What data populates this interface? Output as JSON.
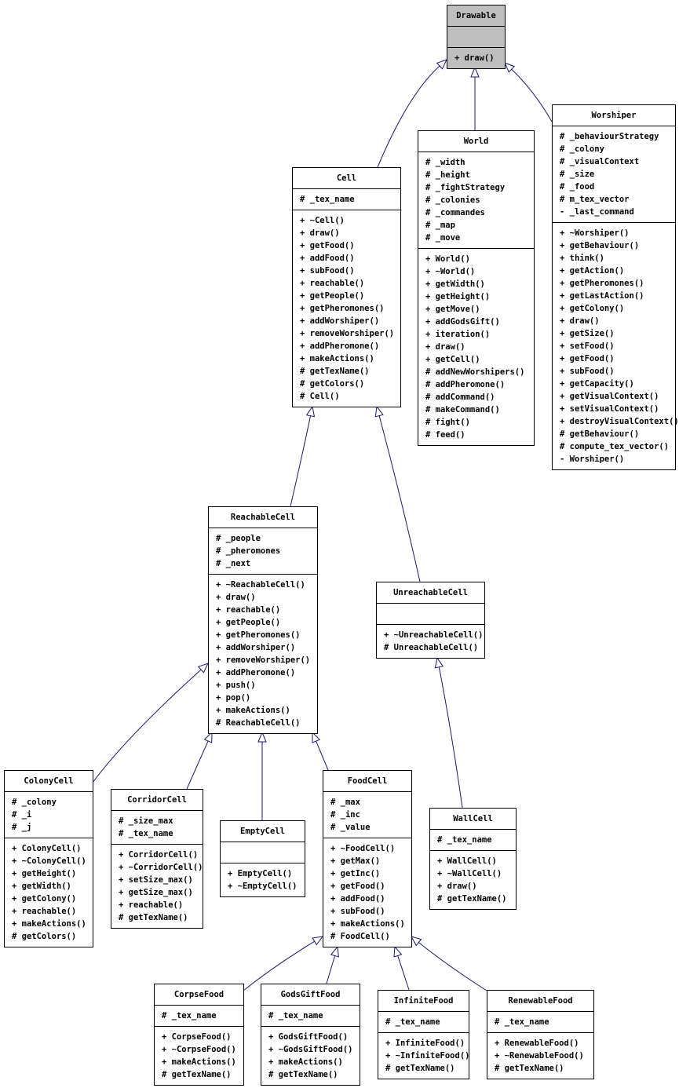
{
  "diagram": {
    "line_color": "#191970",
    "highlight_color": "#bfbfbf",
    "classes": [
      {
        "id": "Drawable",
        "name": "Drawable",
        "highlighted": true,
        "attributes": [],
        "methods": [
          "+ draw()"
        ]
      },
      {
        "id": "World",
        "name": "World",
        "attributes": [
          "# _width",
          "# _height",
          "# _fightStrategy",
          "# _colonies",
          "# _commandes",
          "# _map",
          "# _move"
        ],
        "methods": [
          "+ World()",
          "+ ~World()",
          "+ getWidth()",
          "+ getHeight()",
          "+ getMove()",
          "+ addGodsGift()",
          "+ iteration()",
          "+ draw()",
          "+ getCell()",
          "# addNewWorshipers()",
          "# addPheromone()",
          "# addCommand()",
          "# makeCommand()",
          "# fight()",
          "# feed()"
        ]
      },
      {
        "id": "Worshiper",
        "name": "Worshiper",
        "attributes": [
          "# _behaviourStrategy",
          "# _colony",
          "# _visualContext",
          "# _size",
          "# _food",
          "# m_tex_vector",
          "- _last_command"
        ],
        "methods": [
          "+ ~Worshiper()",
          "+ getBehaviour()",
          "+ think()",
          "+ getAction()",
          "+ getPheromones()",
          "+ getLastAction()",
          "+ getColony()",
          "+ draw()",
          "+ getSize()",
          "+ setFood()",
          "+ getFood()",
          "+ subFood()",
          "+ getCapacity()",
          "+ getVisualContext()",
          "+ setVisualContext()",
          "+ destroyVisualContext()",
          "# getBehaviour()",
          "# compute_tex_vector()",
          "- Worshiper()"
        ]
      },
      {
        "id": "Cell",
        "name": "Cell",
        "attributes": [
          "# _tex_name"
        ],
        "methods": [
          "+ ~Cell()",
          "+ draw()",
          "+ getFood()",
          "+ addFood()",
          "+ subFood()",
          "+ reachable()",
          "+ getPeople()",
          "+ getPheromones()",
          "+ addWorshiper()",
          "+ removeWorshiper()",
          "+ addPheromone()",
          "+ makeActions()",
          "# getTexName()",
          "# getColors()",
          "# Cell()"
        ]
      },
      {
        "id": "ReachableCell",
        "name": "ReachableCell",
        "attributes": [
          "# _people",
          "# _pheromones",
          "# _next"
        ],
        "methods": [
          "+ ~ReachableCell()",
          "+ draw()",
          "+ reachable()",
          "+ getPeople()",
          "+ getPheromones()",
          "+ addWorshiper()",
          "+ removeWorshiper()",
          "+ addPheromone()",
          "+ push()",
          "+ pop()",
          "+ makeActions()",
          "# ReachableCell()"
        ]
      },
      {
        "id": "UnreachableCell",
        "name": "UnreachableCell",
        "attributes": [],
        "methods": [
          "+ ~UnreachableCell()",
          "# UnreachableCell()"
        ]
      },
      {
        "id": "ColonyCell",
        "name": "ColonyCell",
        "attributes": [
          "# _colony",
          "# _i",
          "# _j"
        ],
        "methods": [
          "+ ColonyCell()",
          "+ ~ColonyCell()",
          "+ getHeight()",
          "+ getWidth()",
          "+ getColony()",
          "+ reachable()",
          "+ makeActions()",
          "# getColors()"
        ]
      },
      {
        "id": "CorridorCell",
        "name": "CorridorCell",
        "attributes": [
          "# _size_max",
          "# _tex_name"
        ],
        "methods": [
          "+ CorridorCell()",
          "+ ~CorridorCell()",
          "+ setSize_max()",
          "+ getSize_max()",
          "+ reachable()",
          "# getTexName()"
        ]
      },
      {
        "id": "EmptyCell",
        "name": "EmptyCell",
        "attributes": [],
        "methods": [
          "+ EmptyCell()",
          "+ ~EmptyCell()"
        ]
      },
      {
        "id": "FoodCell",
        "name": "FoodCell",
        "attributes": [
          "# _max",
          "# _inc",
          "# _value"
        ],
        "methods": [
          "+ ~FoodCell()",
          "+ getMax()",
          "+ getInc()",
          "+ getFood()",
          "+ addFood()",
          "+ subFood()",
          "+ makeActions()",
          "# FoodCell()"
        ]
      },
      {
        "id": "WallCell",
        "name": "WallCell",
        "attributes": [
          "# _tex_name"
        ],
        "methods": [
          "+ WallCell()",
          "+ ~WallCell()",
          "+ draw()",
          "# getTexName()"
        ]
      },
      {
        "id": "CorpseFood",
        "name": "CorpseFood",
        "attributes": [
          "# _tex_name"
        ],
        "methods": [
          "+ CorpseFood()",
          "+ ~CorpseFood()",
          "+ makeActions()",
          "# getTexName()"
        ]
      },
      {
        "id": "GodsGiftFood",
        "name": "GodsGiftFood",
        "attributes": [
          "# _tex_name"
        ],
        "methods": [
          "+ GodsGiftFood()",
          "+ ~GodsGiftFood()",
          "+ makeActions()",
          "# getTexName()"
        ]
      },
      {
        "id": "InfiniteFood",
        "name": "InfiniteFood",
        "attributes": [
          "# _tex_name"
        ],
        "methods": [
          "+ InfiniteFood()",
          "+ ~InfiniteFood()",
          "# getTexName()"
        ]
      },
      {
        "id": "RenewableFood",
        "name": "RenewableFood",
        "attributes": [
          "# _tex_name"
        ],
        "methods": [
          "+ RenewableFood()",
          "+ ~RenewableFood()",
          "# getTexName()"
        ]
      }
    ],
    "inheritance": [
      {
        "child": "Cell",
        "parent": "Drawable"
      },
      {
        "child": "World",
        "parent": "Drawable"
      },
      {
        "child": "Worshiper",
        "parent": "Drawable"
      },
      {
        "child": "ReachableCell",
        "parent": "Cell"
      },
      {
        "child": "UnreachableCell",
        "parent": "Cell"
      },
      {
        "child": "ColonyCell",
        "parent": "ReachableCell"
      },
      {
        "child": "CorridorCell",
        "parent": "ReachableCell"
      },
      {
        "child": "EmptyCell",
        "parent": "ReachableCell"
      },
      {
        "child": "FoodCell",
        "parent": "ReachableCell"
      },
      {
        "child": "WallCell",
        "parent": "UnreachableCell"
      },
      {
        "child": "CorpseFood",
        "parent": "FoodCell"
      },
      {
        "child": "GodsGiftFood",
        "parent": "FoodCell"
      },
      {
        "child": "InfiniteFood",
        "parent": "FoodCell"
      },
      {
        "child": "RenewableFood",
        "parent": "FoodCell"
      }
    ]
  }
}
